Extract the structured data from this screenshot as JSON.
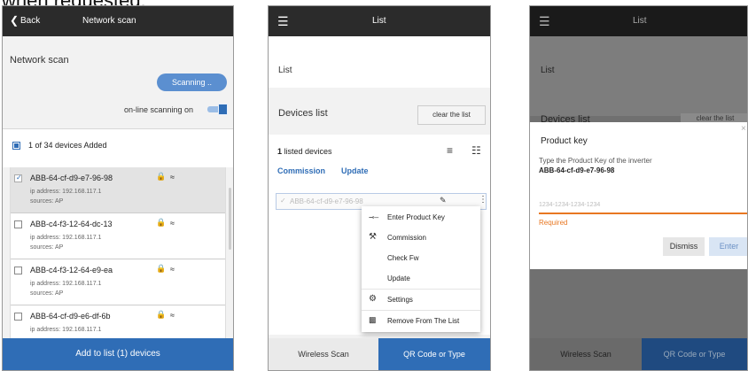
{
  "caption": "when requested:",
  "screen1": {
    "back_label": "Back",
    "title": "Network scan",
    "heading": "Network scan",
    "scanning_button": "Scanning ..",
    "online_label": "on-line scanning on",
    "added_summary": "1 of 34 devices Added",
    "devices": [
      {
        "name": "ABB-64-cf-d9-e7-96-98",
        "ip": "ip address: 192.168.117.1",
        "sources": "sources: AP",
        "checked": true
      },
      {
        "name": "ABB-c4-f3-12-64-dc-13",
        "ip": "ip address: 192.168.117.1",
        "sources": "sources: AP",
        "checked": false
      },
      {
        "name": "ABB-c4-f3-12-64-e9-ea",
        "ip": "ip address: 192.168.117.1",
        "sources": "sources: AP",
        "checked": false
      },
      {
        "name": "ABB-64-cf-d9-e6-df-6b",
        "ip": "ip address: 192.168.117.1",
        "sources": "",
        "checked": false
      }
    ],
    "add_button": "Add to list (1) devices",
    "colors": {
      "accent": "#2f6db6",
      "topbar": "#2b2b2b",
      "selected_row": "#e3e3e3"
    }
  },
  "screen2": {
    "title": "List",
    "heading": "List",
    "devices_list_label": "Devices list",
    "clear_button": "clear the list",
    "listed_count": "1",
    "listed_suffix": "listed devices",
    "commission_link": "Commission",
    "update_link": "Update",
    "device_name": "ABB-64-cf-d9-e7-96-98",
    "menu": [
      {
        "icon": "key-icon",
        "glyph": "⊕",
        "label": "Enter Product Key"
      },
      {
        "icon": "wrench-icon",
        "glyph": "⚒",
        "label": "Commission"
      },
      {
        "icon": "",
        "glyph": "",
        "label": "Check Fw"
      },
      {
        "icon": "",
        "glyph": "",
        "label": "Update"
      },
      {
        "icon": "gear-icon",
        "glyph": "⚙",
        "label": "Settings"
      },
      {
        "icon": "trash-icon",
        "glyph": "✖",
        "label": "Remove From The List"
      }
    ],
    "wireless_button": "Wireless Scan",
    "qr_button": "QR Code or Type"
  },
  "screen3": {
    "title": "List",
    "heading": "List",
    "devices_list_label": "Devices list",
    "clear_button": "clear the list",
    "dialog_title": "Product key",
    "dialog_desc": "Type the Product Key of the inverter",
    "dialog_device": "ABB-64-cf-d9-e7-96-98",
    "input_placeholder": "1234-1234-1234-1234",
    "required_text": "Required",
    "dismiss_button": "Dismiss",
    "enter_button": "Enter",
    "wireless_button": "Wireless Scan",
    "qr_button": "QR Code or Type",
    "colors": {
      "error": "#e87722"
    }
  }
}
